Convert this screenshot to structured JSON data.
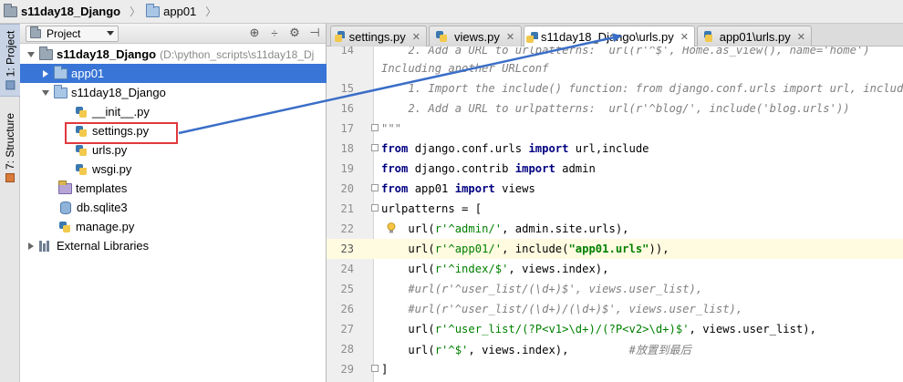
{
  "breadcrumb": [
    {
      "label": "s11day18_Django"
    },
    {
      "label": "app01"
    }
  ],
  "side_tabs": {
    "project": "1: Project",
    "structure": "7: Structure"
  },
  "project_panel": {
    "view_label": "Project",
    "tree": [
      {
        "label": "s11day18_Django",
        "path": "(D:\\python_scripts\\s11day18_Dj",
        "icon": "folder-grey"
      },
      {
        "label": "app01",
        "icon": "folder-blue",
        "selected": true
      },
      {
        "label": "s11day18_Django",
        "icon": "folder-blue"
      },
      {
        "label": "__init__.py",
        "icon": "python-file-icon"
      },
      {
        "label": "settings.py",
        "icon": "python-file-icon"
      },
      {
        "label": "urls.py",
        "icon": "python-file-icon"
      },
      {
        "label": "wsgi.py",
        "icon": "python-file-icon"
      },
      {
        "label": "templates",
        "icon": "folder-purple"
      },
      {
        "label": "db.sqlite3",
        "icon": "database-icon"
      },
      {
        "label": "manage.py",
        "icon": "python-file-icon"
      },
      {
        "label": "External Libraries",
        "icon": "library-icon"
      }
    ]
  },
  "editor_tabs": [
    {
      "label": "settings.py"
    },
    {
      "label": "views.py"
    },
    {
      "label": "s11day18_Django\\urls.py",
      "active": true
    },
    {
      "label": "app01\\urls.py"
    }
  ],
  "editor": {
    "lines": [
      {
        "n": "14",
        "text": "    2. Add a URL to urlpatterns:  url(r'^$', Home.as_view(), name='home')"
      },
      {
        "n": "",
        "text": "Including another URLconf"
      },
      {
        "n": "15",
        "text": "    1. Import the include() function: from django.conf.urls import url, include"
      },
      {
        "n": "16",
        "text": "    2. Add a URL to urlpatterns:  url(r'^blog/', include('blog.urls'))"
      },
      {
        "n": "17",
        "text": "\"\"\""
      },
      {
        "n": "18",
        "p1": "from",
        "p2": " django.conf.urls ",
        "p3": "import",
        "p4": " url,include"
      },
      {
        "n": "19",
        "p1": "from",
        "p2": " django.contrib ",
        "p3": "import",
        "p4": " admin"
      },
      {
        "n": "20",
        "p1": "from",
        "p2": " app01 ",
        "p3": "import",
        "p4": " views"
      },
      {
        "n": "21",
        "text": "urlpatterns = ["
      },
      {
        "n": "22",
        "p1": "    url(",
        "p2": "r'^admin/'",
        "p3": ", admin.site.urls),"
      },
      {
        "n": "23",
        "p1": "    url(",
        "p2": "r'^app01/'",
        "p3": ", include(",
        "p4": "\"app01.urls\"",
        "p5": ")),"
      },
      {
        "n": "24",
        "p1": "    url(",
        "p2": "r'^index/$'",
        "p3": ", views.index),"
      },
      {
        "n": "25",
        "text": "    #url(r'^user_list/(\\d+)$', views.user_list),"
      },
      {
        "n": "26",
        "text": "    #url(r'^user_list/(\\d+)/(\\d+)$', views.user_list),"
      },
      {
        "n": "27",
        "p1": "    url(",
        "p2": "r'^user_list/(?P<v1>\\d+)/(?P<v2>\\d+)$'",
        "p3": ", views.user_list),"
      },
      {
        "n": "28",
        "p1": "    url(",
        "p2": "r'^$'",
        "p3": ", views.index),",
        "p4": "         #放置到最后"
      },
      {
        "n": "29",
        "text": "]"
      }
    ]
  },
  "colors": {
    "selection": "#3875d7",
    "annotation_box": "#e0393e",
    "annotation_arrow": "#3a6ec8",
    "keyword": "#000080",
    "string": "#008000",
    "comment": "#808080",
    "current_line": "#fffbe0"
  }
}
